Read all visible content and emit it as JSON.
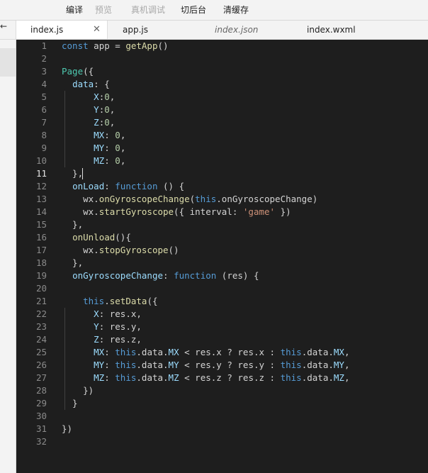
{
  "toolbar": {
    "items": [
      "编译",
      "预览",
      "真机调试",
      "切后台",
      "清缓存"
    ]
  },
  "left": {
    "back": "←"
  },
  "tabs": [
    "index.js",
    "app.js",
    "index.json",
    "index.wxml"
  ],
  "close_glyph": "✕",
  "editor": {
    "line_numbers": [
      "1",
      "2",
      "3",
      "4",
      "5",
      "6",
      "7",
      "8",
      "9",
      "10",
      "11",
      "12",
      "13",
      "14",
      "15",
      "16",
      "17",
      "18",
      "19",
      "20",
      "21",
      "22",
      "23",
      "24",
      "25",
      "26",
      "27",
      "28",
      "29",
      "30",
      "31",
      "32"
    ],
    "current_line": "11",
    "lines": [
      [
        [
          "const",
          "kw"
        ],
        [
          " app = ",
          ""
        ],
        [
          "getApp",
          "fn"
        ],
        [
          "()",
          ""
        ]
      ],
      [],
      [
        [
          "Page",
          "cls"
        ],
        [
          "({",
          ""
        ]
      ],
      [
        [
          "  ",
          ""
        ],
        [
          "data",
          "prop"
        ],
        [
          ": {",
          ""
        ]
      ],
      [
        [
          "      ",
          ""
        ],
        [
          "X",
          "prop"
        ],
        [
          ":",
          ""
        ],
        [
          "0",
          "num"
        ],
        [
          ",",
          ""
        ]
      ],
      [
        [
          "      ",
          ""
        ],
        [
          "Y",
          "prop"
        ],
        [
          ":",
          ""
        ],
        [
          "0",
          "num"
        ],
        [
          ",",
          ""
        ]
      ],
      [
        [
          "      ",
          ""
        ],
        [
          "Z",
          "prop"
        ],
        [
          ":",
          ""
        ],
        [
          "0",
          "num"
        ],
        [
          ",",
          ""
        ]
      ],
      [
        [
          "      ",
          ""
        ],
        [
          "MX",
          "prop"
        ],
        [
          ": ",
          ""
        ],
        [
          "0",
          "num"
        ],
        [
          ",",
          ""
        ]
      ],
      [
        [
          "      ",
          ""
        ],
        [
          "MY",
          "prop"
        ],
        [
          ": ",
          ""
        ],
        [
          "0",
          "num"
        ],
        [
          ",",
          ""
        ]
      ],
      [
        [
          "      ",
          ""
        ],
        [
          "MZ",
          "prop"
        ],
        [
          ": ",
          ""
        ],
        [
          "0",
          "num"
        ],
        [
          ",",
          ""
        ]
      ],
      [
        [
          "  },",
          ""
        ]
      ],
      [
        [
          "  ",
          ""
        ],
        [
          "onLoad",
          "prop"
        ],
        [
          ": ",
          ""
        ],
        [
          "function",
          "kw"
        ],
        [
          " () {",
          ""
        ]
      ],
      [
        [
          "    wx.",
          ""
        ],
        [
          "onGyroscopeChange",
          "fn"
        ],
        [
          "(",
          ""
        ],
        [
          "this",
          "kw"
        ],
        [
          ".onGyroscopeChange)",
          ""
        ]
      ],
      [
        [
          "    wx.",
          ""
        ],
        [
          "startGyroscope",
          "fn"
        ],
        [
          "({ interval: ",
          ""
        ],
        [
          "'game'",
          "str"
        ],
        [
          " })",
          ""
        ]
      ],
      [
        [
          "  },",
          ""
        ]
      ],
      [
        [
          "  ",
          ""
        ],
        [
          "onUnload",
          "fn"
        ],
        [
          "(){",
          ""
        ]
      ],
      [
        [
          "    wx.",
          ""
        ],
        [
          "stopGyroscope",
          "fn"
        ],
        [
          "()",
          ""
        ]
      ],
      [
        [
          "  },",
          ""
        ]
      ],
      [
        [
          "  ",
          ""
        ],
        [
          "onGyroscopeChange",
          "prop"
        ],
        [
          ": ",
          ""
        ],
        [
          "function",
          "kw"
        ],
        [
          " (res) {",
          ""
        ]
      ],
      [],
      [
        [
          "    ",
          ""
        ],
        [
          "this",
          "kw"
        ],
        [
          ".",
          ""
        ],
        [
          "setData",
          "fn"
        ],
        [
          "({",
          ""
        ]
      ],
      [
        [
          "      ",
          ""
        ],
        [
          "X",
          "prop"
        ],
        [
          ": res.x,",
          ""
        ]
      ],
      [
        [
          "      ",
          ""
        ],
        [
          "Y",
          "prop"
        ],
        [
          ": res.y,",
          ""
        ]
      ],
      [
        [
          "      ",
          ""
        ],
        [
          "Z",
          "prop"
        ],
        [
          ": res.z,",
          ""
        ]
      ],
      [
        [
          "      ",
          ""
        ],
        [
          "MX",
          "prop"
        ],
        [
          ": ",
          ""
        ],
        [
          "this",
          "kw"
        ],
        [
          ".data.",
          ""
        ],
        [
          "MX",
          "prop"
        ],
        [
          " < res.x ? res.x : ",
          ""
        ],
        [
          "this",
          "kw"
        ],
        [
          ".data.",
          ""
        ],
        [
          "MX",
          "prop"
        ],
        [
          ",",
          ""
        ]
      ],
      [
        [
          "      ",
          ""
        ],
        [
          "MY",
          "prop"
        ],
        [
          ": ",
          ""
        ],
        [
          "this",
          "kw"
        ],
        [
          ".data.",
          ""
        ],
        [
          "MY",
          "prop"
        ],
        [
          " < res.y ? res.y : ",
          ""
        ],
        [
          "this",
          "kw"
        ],
        [
          ".data.",
          ""
        ],
        [
          "MY",
          "prop"
        ],
        [
          ",",
          ""
        ]
      ],
      [
        [
          "      ",
          ""
        ],
        [
          "MZ",
          "prop"
        ],
        [
          ": ",
          ""
        ],
        [
          "this",
          "kw"
        ],
        [
          ".data.",
          ""
        ],
        [
          "MZ",
          "prop"
        ],
        [
          " < res.z ? res.z : ",
          ""
        ],
        [
          "this",
          "kw"
        ],
        [
          ".data.",
          ""
        ],
        [
          "MZ",
          "prop"
        ],
        [
          ",",
          ""
        ]
      ],
      [
        [
          "    })",
          ""
        ]
      ],
      [
        [
          "  }",
          ""
        ]
      ],
      [],
      [
        [
          "})",
          ""
        ]
      ],
      []
    ]
  }
}
